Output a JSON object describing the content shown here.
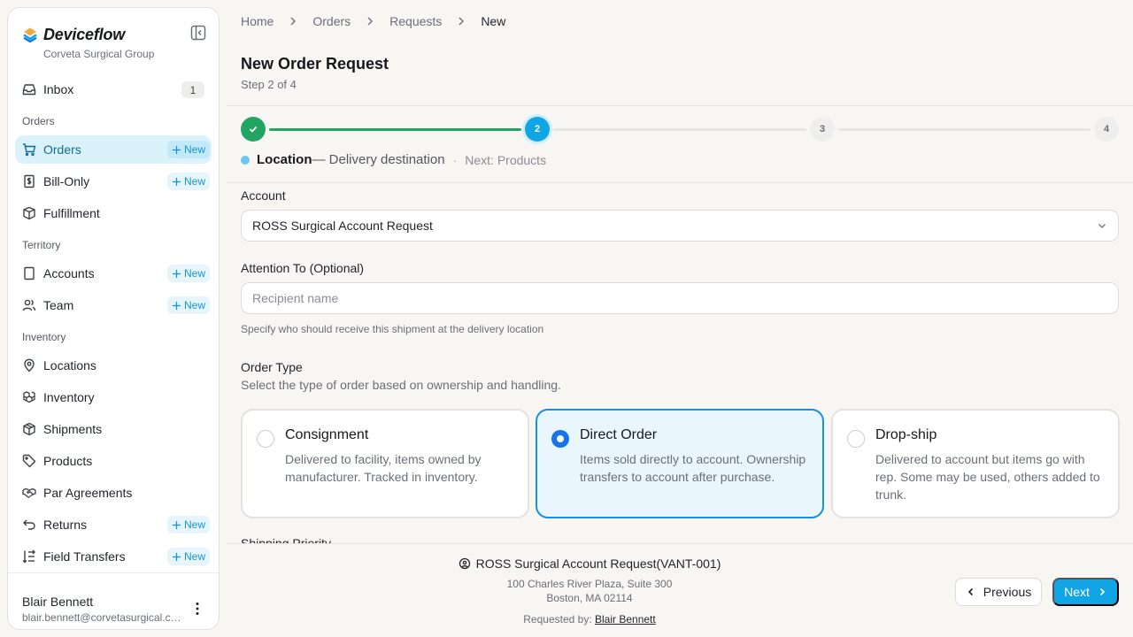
{
  "app": {
    "name": "Deviceflow",
    "org": "Corveta Surgical Group"
  },
  "sidebar": {
    "inbox": {
      "label": "Inbox",
      "count": "1"
    },
    "sections": {
      "orders": "Orders",
      "territory": "Territory",
      "inventory": "Inventory"
    },
    "new_label": "New",
    "items": {
      "orders": "Orders",
      "bill_only": "Bill-Only",
      "fulfillment": "Fulfillment",
      "accounts": "Accounts",
      "team": "Team",
      "locations": "Locations",
      "inventory": "Inventory",
      "shipments": "Shipments",
      "products": "Products",
      "par_agreements": "Par Agreements",
      "returns": "Returns",
      "field_transfers": "Field Transfers"
    },
    "user": {
      "name": "Blair Bennett",
      "email": "blair.bennett@corvetasurgical.com"
    }
  },
  "breadcrumb": [
    "Home",
    "Orders",
    "Requests",
    "New"
  ],
  "page": {
    "title": "New Order Request",
    "subtitle": "Step 2 of 4"
  },
  "stepper": {
    "current_step": 2,
    "total_steps": 4,
    "steps": [
      "",
      "2",
      "3",
      "4"
    ],
    "caption_title": "Location",
    "caption_desc": "— Delivery destination",
    "caption_sep": "·",
    "caption_next": "Next: Products"
  },
  "form": {
    "account_label": "Account",
    "account_value": "ROSS Surgical Account Request",
    "attention_label": "Attention To (Optional)",
    "attention_placeholder": "Recipient name",
    "attention_value": "",
    "attention_helper": "Specify who should receive this shipment at the delivery location",
    "order_type_label": "Order Type",
    "order_type_helper": "Select the type of order based on ownership and handling.",
    "order_types": [
      {
        "title": "Consignment",
        "desc": "Delivered to facility, items owned by manufacturer. Tracked in inventory.",
        "selected": false
      },
      {
        "title": "Direct Order",
        "desc": "Items sold directly to account. Ownership transfers to account after purchase.",
        "selected": true
      },
      {
        "title": "Drop-ship",
        "desc": "Delivered to account but items go with rep. Some may be used, others added to trunk.",
        "selected": false
      }
    ],
    "shipping_priority_label": "Shipping Priority"
  },
  "footer": {
    "account_line": "ROSS Surgical Account Request(VANT-001)",
    "address1": "100 Charles River Plaza, Suite 300",
    "address2": "Boston, MA 02114",
    "requested_by_label": "Requested by:",
    "requested_by_name": "Blair Bennett",
    "previous_label": "Previous",
    "next_label": "Next"
  },
  "colors": {
    "accent": "#12a5e6",
    "success": "#22a463",
    "selected_border": "#1a8fe0",
    "active_nav_bg": "#dcf2fb"
  }
}
